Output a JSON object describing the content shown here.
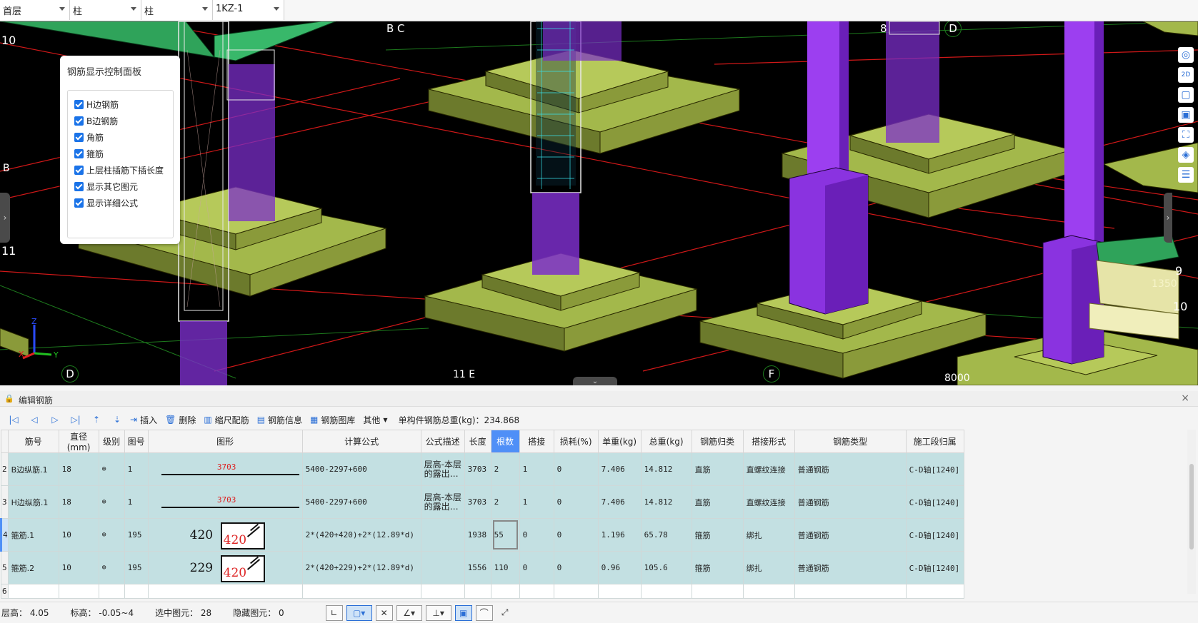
{
  "top_selectors": [
    {
      "value": "首层"
    },
    {
      "value": "柱"
    },
    {
      "value": "柱"
    },
    {
      "value": "1KZ-1"
    }
  ],
  "panel": {
    "title": "钢筋显示控制面板",
    "options": [
      {
        "label": "H边钢筋",
        "checked": true
      },
      {
        "label": "B边钢筋",
        "checked": true
      },
      {
        "label": "角筋",
        "checked": true
      },
      {
        "label": "箍筋",
        "checked": true
      },
      {
        "label": "上层柱插筋下插长度",
        "checked": true
      },
      {
        "label": "显示其它图元",
        "checked": true
      },
      {
        "label": "显示详细公式",
        "checked": true
      }
    ]
  },
  "viewport": {
    "grid_labels": {
      "g10": "10",
      "g11": "11",
      "gB": "B",
      "gBC": "B C",
      "gD": "D",
      "g11E": "11 E",
      "gF": "F",
      "g8": "8",
      "gD2": "D",
      "g9": "9",
      "g10r": "10",
      "dim1350": "1350",
      "dim8000": "8000"
    }
  },
  "pane": {
    "title": "编辑钢筋"
  },
  "toolbar": {
    "insert": "插入",
    "delete": "删除",
    "scale_rebar": "缩尺配筋",
    "rebar_info": "钢筋信息",
    "rebar_library": "钢筋图库",
    "other": "其他",
    "total_weight": "单构件钢筋总重(kg)：234.868"
  },
  "table": {
    "headers": [
      "筋号",
      "直径(mm)",
      "级别",
      "图号",
      "图形",
      "计算公式",
      "公式描述",
      "长度",
      "根数",
      "搭接",
      "损耗(%)",
      "单重(kg)",
      "总重(kg)",
      "钢筋归类",
      "搭接形式",
      "钢筋类型",
      "施工段归属"
    ],
    "rows": [
      {
        "row_num": "2",
        "name": "B边纵筋.1",
        "dia": "18",
        "grade": "⊕",
        "fig": "1",
        "shape_val": "3703",
        "formula": "5400-2297+600",
        "desc": "层高-本层的露出…",
        "length": "3703",
        "count": "2",
        "lap": "1",
        "loss": "0",
        "unit_w": "7.406",
        "total_w": "14.812",
        "category": "直筋",
        "lap_type": "直螺纹连接",
        "rebar_type": "普通钢筋",
        "segment": "C-D轴[1240]"
      },
      {
        "row_num": "3",
        "name": "H边纵筋.1",
        "dia": "18",
        "grade": "⊕",
        "fig": "1",
        "shape_val": "3703",
        "formula": "5400-2297+600",
        "desc": "层高-本层的露出…",
        "length": "3703",
        "count": "2",
        "lap": "1",
        "loss": "0",
        "unit_w": "7.406",
        "total_w": "14.812",
        "category": "直筋",
        "lap_type": "直螺纹连接",
        "rebar_type": "普通钢筋",
        "segment": "C-D轴[1240]"
      },
      {
        "row_num": "4",
        "name": "箍筋.1",
        "dia": "10",
        "grade": "⊕",
        "fig": "195",
        "shape_dim": "420",
        "shape_inner": "420",
        "formula": "2*(420+420)+2*(12.89*d)",
        "desc": "",
        "length": "1938",
        "count": "55",
        "lap": "0",
        "loss": "0",
        "unit_w": "1.196",
        "total_w": "65.78",
        "category": "箍筋",
        "lap_type": "绑扎",
        "rebar_type": "普通钢筋",
        "segment": "C-D轴[1240]"
      },
      {
        "row_num": "5",
        "name": "箍筋.2",
        "dia": "10",
        "grade": "⊕",
        "fig": "195",
        "shape_dim": "229",
        "shape_inner": "420",
        "formula": "2*(420+229)+2*(12.89*d)",
        "desc": "",
        "length": "1556",
        "count": "110",
        "lap": "0",
        "loss": "0",
        "unit_w": "0.96",
        "total_w": "105.6",
        "category": "箍筋",
        "lap_type": "绑扎",
        "rebar_type": "普通钢筋",
        "segment": "C-D轴[1240]"
      }
    ],
    "empty_row_num": "6"
  },
  "status": {
    "floor_height": "层高：  4.05",
    "elevation": "标高：  -0.05~4",
    "selected": "选中图元：  28",
    "hidden": "隐藏图元：  0"
  }
}
